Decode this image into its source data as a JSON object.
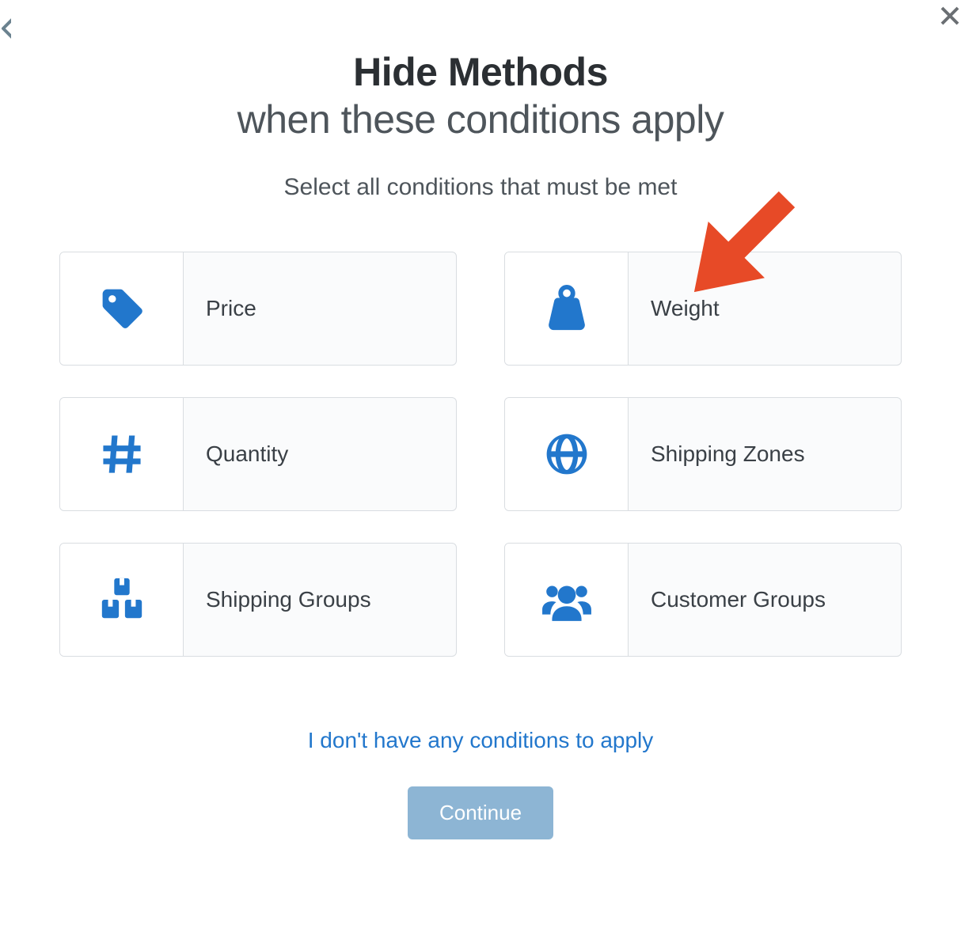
{
  "header": {
    "title_bold": "Hide Methods",
    "title_light": "when these conditions apply",
    "subtitle": "Select all conditions that must be met"
  },
  "conditions": [
    {
      "id": "price",
      "label": "Price",
      "icon": "tag-icon"
    },
    {
      "id": "weight",
      "label": "Weight",
      "icon": "weight-icon"
    },
    {
      "id": "quantity",
      "label": "Quantity",
      "icon": "hash-icon"
    },
    {
      "id": "shipping-zones",
      "label": "Shipping Zones",
      "icon": "globe-icon"
    },
    {
      "id": "shipping-groups",
      "label": "Shipping Groups",
      "icon": "boxes-icon"
    },
    {
      "id": "customer-groups",
      "label": "Customer Groups",
      "icon": "users-icon"
    }
  ],
  "actions": {
    "no_conditions_link": "I don't have any conditions to apply",
    "continue_label": "Continue"
  },
  "annotation": {
    "arrow_target": "weight"
  },
  "colors": {
    "accent": "#2277cc",
    "arrow": "#e74a27",
    "button": "#8db5d4"
  }
}
